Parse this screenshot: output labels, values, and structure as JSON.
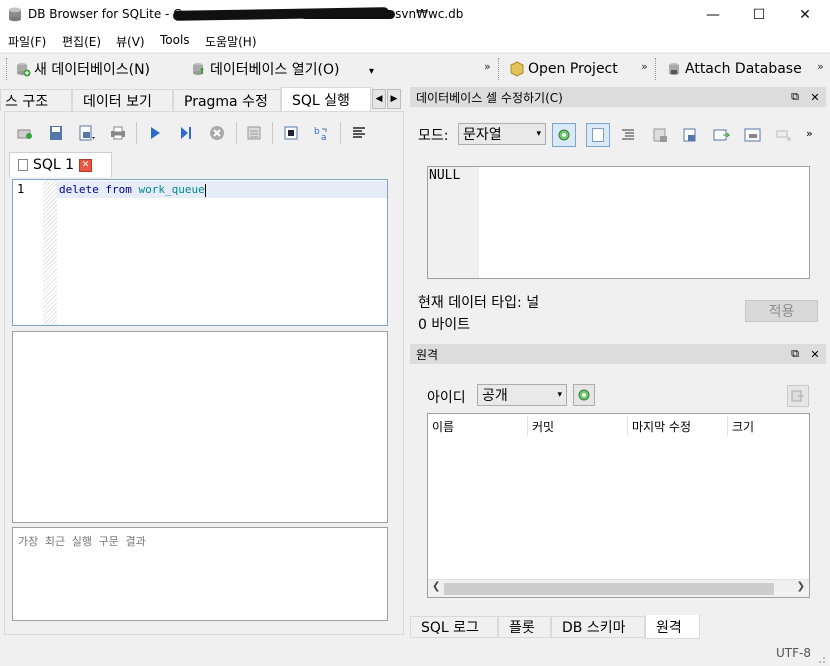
{
  "window": {
    "title_prefix": "DB Browser for SQLite - C:",
    "title_suffix": "w.svn₩wc.db",
    "minimize": "—",
    "maximize": "☐",
    "close": "✕"
  },
  "menu": [
    "파일(F)",
    "편집(E)",
    "뷰(V)",
    "Tools",
    "도움말(H)"
  ],
  "toolbar": {
    "new_db": "새 데이터베이스(N)",
    "open_db": "데이터베이스 열기(O)",
    "open_project": "Open Project",
    "attach_db": "Attach Database",
    "overflow": "»"
  },
  "left_tabs": {
    "structure": "스 구조",
    "browse": "데이터 보기",
    "pragma": "Pragma 수정",
    "execute": "SQL 실행",
    "active": "execute"
  },
  "sql": {
    "tab_label": "SQL 1",
    "line_number": "1",
    "code_kw1": "delete",
    "code_kw2": "from",
    "code_ident": "work_queue",
    "message_placeholder": "가장 최근 실행 구문 결과"
  },
  "edit_cell": {
    "title": "데이터베이스 셀 수정하기(C)",
    "mode_label": "모드:",
    "mode_value": "문자열",
    "value": "NULL",
    "type_text": "현재 데이터 타입: 널",
    "size_text": "0 바이트",
    "apply_label": "적용"
  },
  "remote": {
    "title": "원격",
    "id_label": "아이디",
    "id_value": "공개",
    "columns": [
      "이름",
      "커밋",
      "마지막 수정",
      "크기"
    ]
  },
  "bottom_tabs": [
    "SQL 로그",
    "플롯",
    "DB 스키마",
    "원격"
  ],
  "status": {
    "encoding": "UTF-8"
  },
  "colors": {
    "keyword": "#00008b",
    "identifier": "#008b8b",
    "close_red": "#e8573f"
  }
}
